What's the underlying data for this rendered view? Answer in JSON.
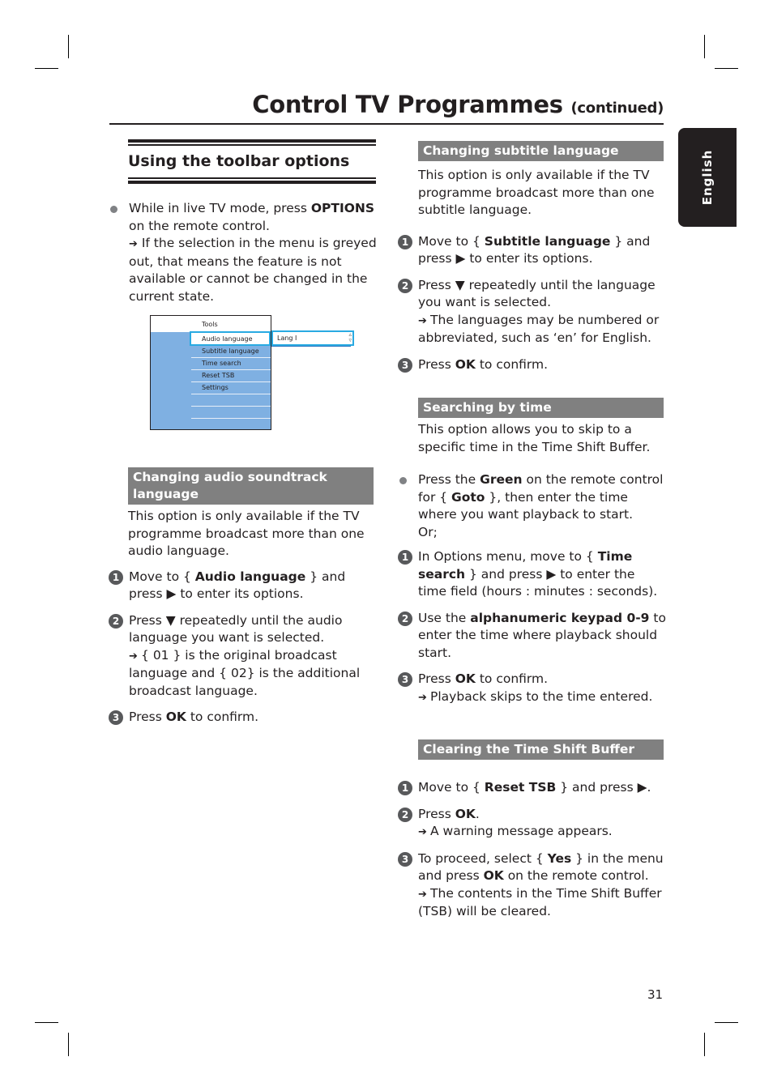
{
  "header": {
    "title": "Control TV Programmes",
    "title_suffix": "(continued)",
    "language_tab": "English"
  },
  "left": {
    "section_title": "Using the toolbar options",
    "intro_bullet": {
      "text_before": "While in live TV mode, press ",
      "bold": "OPTIONS",
      "text_after": " on the remote control.",
      "note": "If the selection in the menu is greyed out, that means the feature is not available or cannot be changed in the current state."
    },
    "menu": {
      "header": "Tools",
      "items": [
        "Audio language",
        "Subtitle language",
        "Time search",
        "Reset TSB",
        "Settings"
      ],
      "selected_index": 0,
      "submenu_value": "Lang I"
    },
    "audio": {
      "heading": "Changing audio soundtrack language",
      "intro": "This option is only available if the TV programme broadcast more than one audio language.",
      "steps": [
        {
          "num": "1",
          "pre": "Move to { ",
          "bold": "Audio language",
          "post": " } and press ▶ to enter its options."
        },
        {
          "num": "2",
          "pre": "Press ▼ repeatedly until the audio language you want is selected.",
          "note": "{ 01 } is the original broadcast language and { 02} is the additional broadcast language."
        },
        {
          "num": "3",
          "pre": "Press ",
          "bold": "OK",
          "post": " to confirm."
        }
      ]
    }
  },
  "right": {
    "subtitle": {
      "heading": "Changing subtitle language",
      "intro": "This option is only available if the TV programme broadcast more than one subtitle language.",
      "steps": [
        {
          "num": "1",
          "pre": "Move to { ",
          "bold": "Subtitle language",
          "post": " } and press ▶ to enter its options."
        },
        {
          "num": "2",
          "pre": "Press ▼ repeatedly until the language you want is selected.",
          "note": "The languages may be numbered or abbreviated, such as ‘en’ for English."
        },
        {
          "num": "3",
          "pre": "Press ",
          "bold": "OK",
          "post": " to confirm."
        }
      ]
    },
    "time": {
      "heading": "Searching by time",
      "intro": "This option allows you to skip to a specific time in the Time Shift Buffer.",
      "bullet": {
        "pre": "Press the ",
        "bold1": "Green",
        "mid": " on the remote control for { ",
        "bold2": "Goto",
        "post": " }, then enter the time where you want playback to start.",
        "or": "Or;"
      },
      "steps": [
        {
          "num": "1",
          "pre": "In Options menu, move to { ",
          "bold": "Time search",
          "post": " } and press ▶ to enter the time field (hours : minutes : seconds)."
        },
        {
          "num": "2",
          "pre": "Use the ",
          "bold": "alphanumeric keypad 0-9",
          "post": " to enter the time where playback should start."
        },
        {
          "num": "3",
          "pre": "Press ",
          "bold": "OK",
          "post": " to confirm.",
          "note": "Playback skips to the time entered."
        }
      ]
    },
    "clear": {
      "heading": "Clearing the Time Shift Buffer",
      "steps": [
        {
          "num": "1",
          "pre": "Move to { ",
          "bold": "Reset TSB",
          "post": " } and press ▶."
        },
        {
          "num": "2",
          "pre": "Press ",
          "bold": "OK",
          "post": ".",
          "note": "A warning message appears."
        },
        {
          "num": "3",
          "pre": "To proceed, select { ",
          "bold": "Yes",
          "post": " } in the menu and press ",
          "bold2": "OK",
          "post2": " on the remote control.",
          "note": "The contents in the Time Shift Buffer (TSB) will be cleared."
        }
      ]
    }
  },
  "footer": {
    "page_number": "31"
  },
  "arrow_glyph": "➔"
}
